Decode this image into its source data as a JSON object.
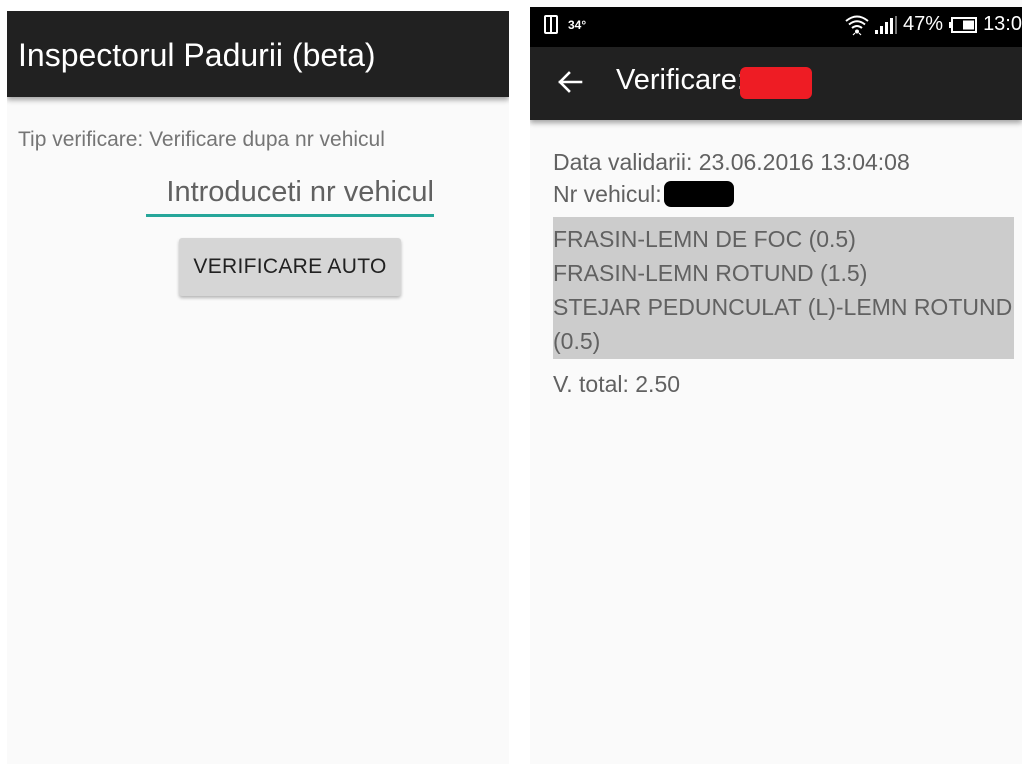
{
  "left_screen": {
    "app_title": "Inspectorul Padurii (beta)",
    "tip_label": "Tip verificare: Verificare dupa nr vehicul",
    "vehicle_input": {
      "placeholder": "Introduceti nr vehicul",
      "value": ""
    },
    "verify_button_label": "VERIFICARE AUTO"
  },
  "right_screen": {
    "status_bar": {
      "temperature": "34°",
      "battery_percent": "47%",
      "time": "13:0"
    },
    "app_bar": {
      "title": "Verificare:"
    },
    "details": {
      "validation_date": "Data validarii: 23.06.2016 13:04:08",
      "vehicle_label": "Nr vehicul:",
      "species": [
        "FRASIN-LEMN DE FOC (0.5)",
        "FRASIN-LEMN ROTUND (1.5)",
        "STEJAR PEDUNCULAT (L)-LEMN ROTUND (0.5)"
      ],
      "total": "V. total: 2.50"
    }
  },
  "colors": {
    "app_bar": "#212121",
    "accent": "#26a69a",
    "button": "#d6d6d6",
    "highlight_box": "#cccccc",
    "redaction_red": "#ee1c24",
    "redaction_black": "#000000"
  },
  "icons": [
    "phone-icon",
    "wifi-icon",
    "signal-icon",
    "battery-icon",
    "back-arrow-icon"
  ]
}
